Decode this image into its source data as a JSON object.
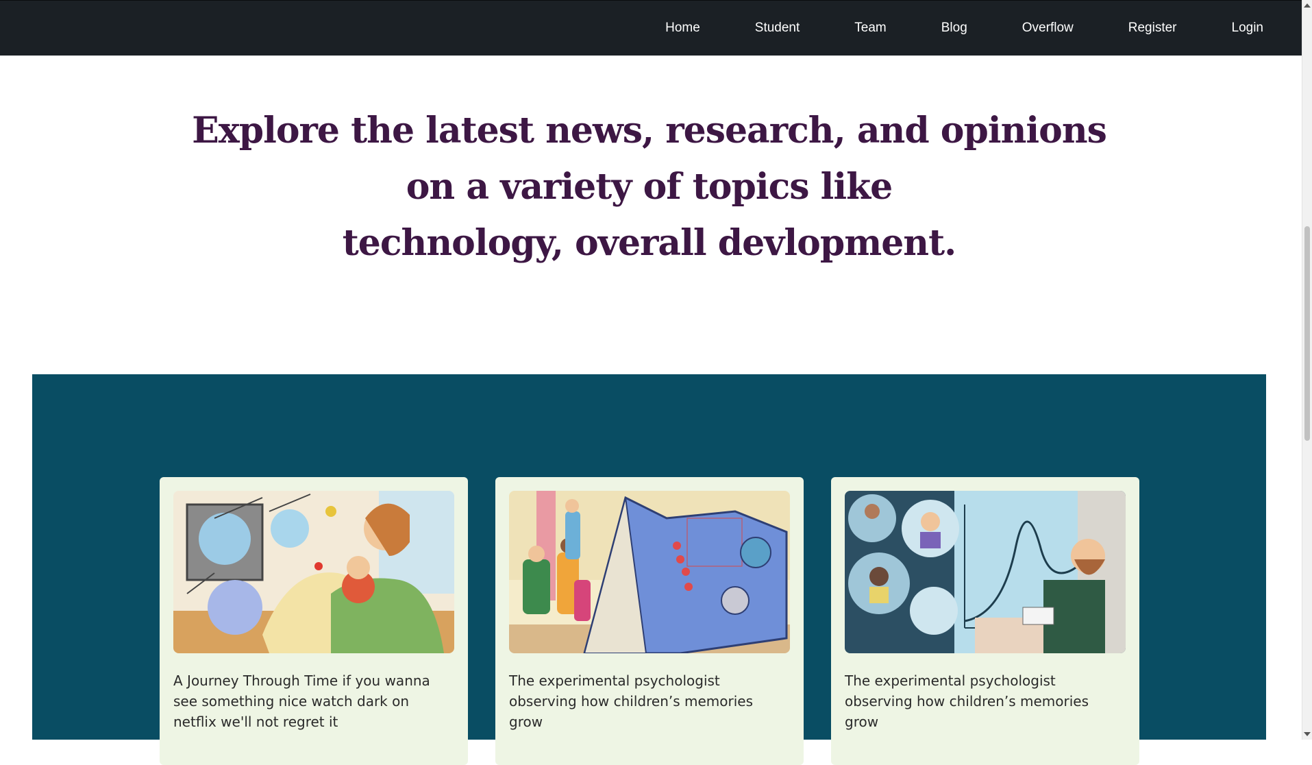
{
  "nav": {
    "items": [
      "Home",
      "Student",
      "Team",
      "Blog",
      "Overflow",
      "Register",
      "Login"
    ]
  },
  "hero": {
    "lines": [
      "Explore the latest news, research, and opinions",
      "on a variety of topics like",
      "technology, overall devlopment."
    ]
  },
  "cards": [
    {
      "title": "A Journey Through Time if you wanna see something nice watch dark on netflix we'll not regret it",
      "image_icon": "illustration-neurons-father-baby"
    },
    {
      "title": "The experimental psychologist observing how children’s memories grow",
      "image_icon": "illustration-children-giant-book"
    },
    {
      "title": "The experimental psychologist observing how children’s memories grow",
      "image_icon": "illustration-man-computer-graph"
    }
  ],
  "colors": {
    "navbar": "#1b2025",
    "hero_text": "#3d1744",
    "section_bg": "#094d63",
    "card_bg": "#eef5e4"
  }
}
